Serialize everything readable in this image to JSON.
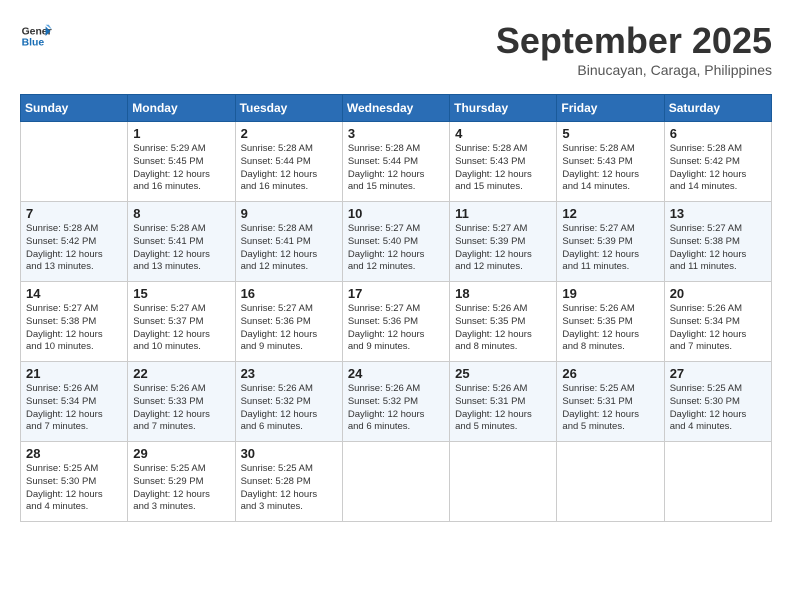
{
  "header": {
    "logo_line1": "General",
    "logo_line2": "Blue",
    "month": "September 2025",
    "location": "Binucayan, Caraga, Philippines"
  },
  "weekdays": [
    "Sunday",
    "Monday",
    "Tuesday",
    "Wednesday",
    "Thursday",
    "Friday",
    "Saturday"
  ],
  "weeks": [
    [
      {
        "day": "",
        "info": ""
      },
      {
        "day": "1",
        "info": "Sunrise: 5:29 AM\nSunset: 5:45 PM\nDaylight: 12 hours\nand 16 minutes."
      },
      {
        "day": "2",
        "info": "Sunrise: 5:28 AM\nSunset: 5:44 PM\nDaylight: 12 hours\nand 16 minutes."
      },
      {
        "day": "3",
        "info": "Sunrise: 5:28 AM\nSunset: 5:44 PM\nDaylight: 12 hours\nand 15 minutes."
      },
      {
        "day": "4",
        "info": "Sunrise: 5:28 AM\nSunset: 5:43 PM\nDaylight: 12 hours\nand 15 minutes."
      },
      {
        "day": "5",
        "info": "Sunrise: 5:28 AM\nSunset: 5:43 PM\nDaylight: 12 hours\nand 14 minutes."
      },
      {
        "day": "6",
        "info": "Sunrise: 5:28 AM\nSunset: 5:42 PM\nDaylight: 12 hours\nand 14 minutes."
      }
    ],
    [
      {
        "day": "7",
        "info": "Sunrise: 5:28 AM\nSunset: 5:42 PM\nDaylight: 12 hours\nand 13 minutes."
      },
      {
        "day": "8",
        "info": "Sunrise: 5:28 AM\nSunset: 5:41 PM\nDaylight: 12 hours\nand 13 minutes."
      },
      {
        "day": "9",
        "info": "Sunrise: 5:28 AM\nSunset: 5:41 PM\nDaylight: 12 hours\nand 12 minutes."
      },
      {
        "day": "10",
        "info": "Sunrise: 5:27 AM\nSunset: 5:40 PM\nDaylight: 12 hours\nand 12 minutes."
      },
      {
        "day": "11",
        "info": "Sunrise: 5:27 AM\nSunset: 5:39 PM\nDaylight: 12 hours\nand 12 minutes."
      },
      {
        "day": "12",
        "info": "Sunrise: 5:27 AM\nSunset: 5:39 PM\nDaylight: 12 hours\nand 11 minutes."
      },
      {
        "day": "13",
        "info": "Sunrise: 5:27 AM\nSunset: 5:38 PM\nDaylight: 12 hours\nand 11 minutes."
      }
    ],
    [
      {
        "day": "14",
        "info": "Sunrise: 5:27 AM\nSunset: 5:38 PM\nDaylight: 12 hours\nand 10 minutes."
      },
      {
        "day": "15",
        "info": "Sunrise: 5:27 AM\nSunset: 5:37 PM\nDaylight: 12 hours\nand 10 minutes."
      },
      {
        "day": "16",
        "info": "Sunrise: 5:27 AM\nSunset: 5:36 PM\nDaylight: 12 hours\nand 9 minutes."
      },
      {
        "day": "17",
        "info": "Sunrise: 5:27 AM\nSunset: 5:36 PM\nDaylight: 12 hours\nand 9 minutes."
      },
      {
        "day": "18",
        "info": "Sunrise: 5:26 AM\nSunset: 5:35 PM\nDaylight: 12 hours\nand 8 minutes."
      },
      {
        "day": "19",
        "info": "Sunrise: 5:26 AM\nSunset: 5:35 PM\nDaylight: 12 hours\nand 8 minutes."
      },
      {
        "day": "20",
        "info": "Sunrise: 5:26 AM\nSunset: 5:34 PM\nDaylight: 12 hours\nand 7 minutes."
      }
    ],
    [
      {
        "day": "21",
        "info": "Sunrise: 5:26 AM\nSunset: 5:34 PM\nDaylight: 12 hours\nand 7 minutes."
      },
      {
        "day": "22",
        "info": "Sunrise: 5:26 AM\nSunset: 5:33 PM\nDaylight: 12 hours\nand 7 minutes."
      },
      {
        "day": "23",
        "info": "Sunrise: 5:26 AM\nSunset: 5:32 PM\nDaylight: 12 hours\nand 6 minutes."
      },
      {
        "day": "24",
        "info": "Sunrise: 5:26 AM\nSunset: 5:32 PM\nDaylight: 12 hours\nand 6 minutes."
      },
      {
        "day": "25",
        "info": "Sunrise: 5:26 AM\nSunset: 5:31 PM\nDaylight: 12 hours\nand 5 minutes."
      },
      {
        "day": "26",
        "info": "Sunrise: 5:25 AM\nSunset: 5:31 PM\nDaylight: 12 hours\nand 5 minutes."
      },
      {
        "day": "27",
        "info": "Sunrise: 5:25 AM\nSunset: 5:30 PM\nDaylight: 12 hours\nand 4 minutes."
      }
    ],
    [
      {
        "day": "28",
        "info": "Sunrise: 5:25 AM\nSunset: 5:30 PM\nDaylight: 12 hours\nand 4 minutes."
      },
      {
        "day": "29",
        "info": "Sunrise: 5:25 AM\nSunset: 5:29 PM\nDaylight: 12 hours\nand 3 minutes."
      },
      {
        "day": "30",
        "info": "Sunrise: 5:25 AM\nSunset: 5:28 PM\nDaylight: 12 hours\nand 3 minutes."
      },
      {
        "day": "",
        "info": ""
      },
      {
        "day": "",
        "info": ""
      },
      {
        "day": "",
        "info": ""
      },
      {
        "day": "",
        "info": ""
      }
    ]
  ]
}
